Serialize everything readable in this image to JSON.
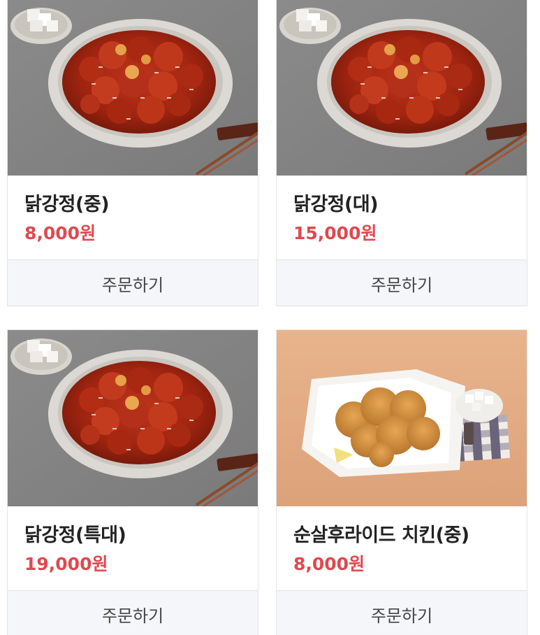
{
  "products": [
    {
      "name": "닭강정(중)",
      "price": "8,000원",
      "button": "주문하기",
      "image": "dakgangjeong-photo"
    },
    {
      "name": "닭강정(대)",
      "price": "15,000원",
      "button": "주문하기",
      "image": "dakgangjeong-photo"
    },
    {
      "name": "닭강정(특대)",
      "price": "19,000원",
      "button": "주문하기",
      "image": "dakgangjeong-photo"
    },
    {
      "name": "순살후라이드 치킨(중)",
      "price": "8,000원",
      "button": "주문하기",
      "image": "fried-chicken-photo"
    }
  ],
  "colors": {
    "price": "#e0484f",
    "button_bg": "#f5f6f9",
    "border": "#e3e5ea"
  }
}
